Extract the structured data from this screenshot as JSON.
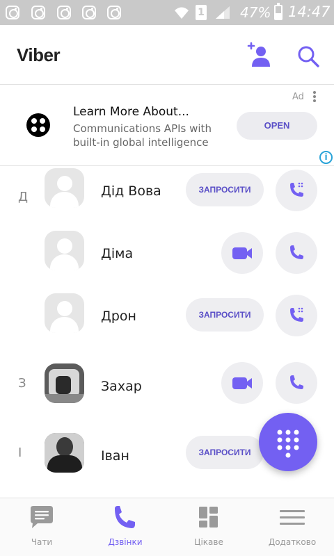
{
  "status_bar": {
    "sim_slot": "1",
    "battery": "47%",
    "battery_level": 0.47,
    "time": "14:47",
    "notification_icons": [
      "instagram-icon",
      "instagram-icon",
      "instagram-icon",
      "instagram-icon",
      "instagram-icon"
    ]
  },
  "header": {
    "title": "Viber",
    "add_contact_icon": "add-contact-icon",
    "search_icon": "search-icon"
  },
  "ad": {
    "title": "Learn More About...",
    "description": "Communications APIs with built-in global intelligence",
    "button_label": "OPEN",
    "badge": "Ad",
    "info_icon": "i"
  },
  "contacts": [
    {
      "letter": "Д",
      "name": "Дід Вова",
      "action": "invite",
      "action_label": "ЗАПРОСИТИ",
      "avatar": "placeholder"
    },
    {
      "letter": "",
      "name": "Діма",
      "action": "video",
      "avatar": "placeholder"
    },
    {
      "letter": "",
      "name": "Дрон",
      "action": "invite",
      "action_label": "ЗАПРОСИТИ",
      "avatar": "placeholder"
    },
    {
      "letter": "З",
      "name": "Захар",
      "action": "video",
      "avatar": "photo"
    },
    {
      "letter": "І",
      "name": "Іван",
      "action": "invite",
      "action_label": "ЗАПРОСИТИ",
      "avatar": "photo"
    }
  ],
  "bottom_nav": [
    {
      "label": "Чати",
      "icon": "chat-icon",
      "active": false
    },
    {
      "label": "Дзвінки",
      "icon": "phone-icon",
      "active": true
    },
    {
      "label": "Цікаве",
      "icon": "explore-icon",
      "active": false
    },
    {
      "label": "Додатково",
      "icon": "menu-icon",
      "active": false
    }
  ],
  "colors": {
    "accent": "#7360f2",
    "accent_dark": "#5a4fc7",
    "status_bar": "#c9c9c9"
  }
}
